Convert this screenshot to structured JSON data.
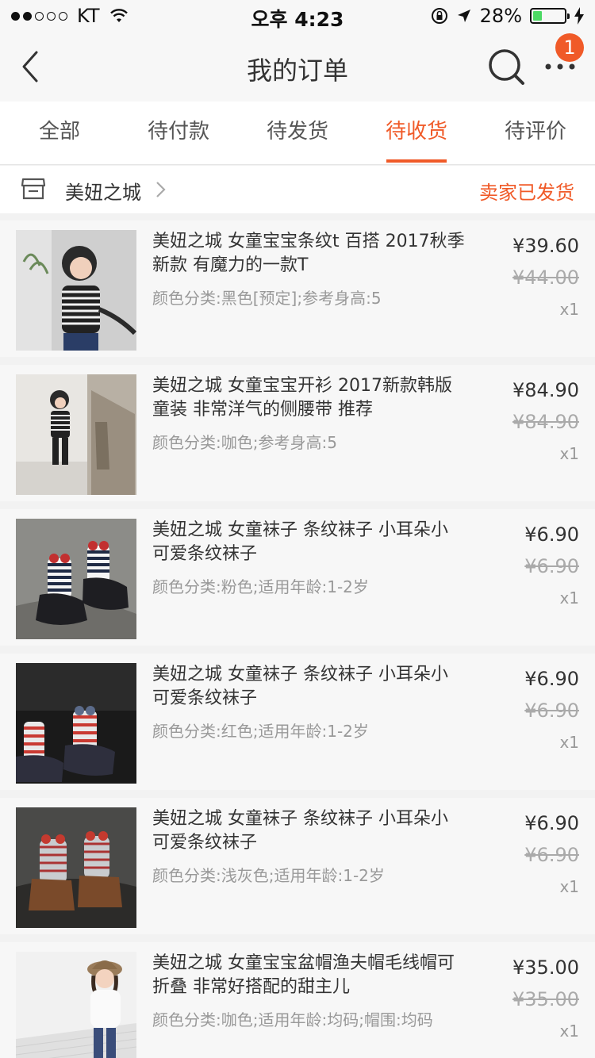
{
  "status_bar": {
    "carrier": "KT",
    "time": "오후 4:23",
    "battery": "28%",
    "battery_level": 0.28
  },
  "nav": {
    "title": "我的订单",
    "badge": "1"
  },
  "tabs": [
    {
      "label": "全部"
    },
    {
      "label": "待付款"
    },
    {
      "label": "待发货"
    },
    {
      "label": "待收货",
      "active": true
    },
    {
      "label": "待评价"
    }
  ],
  "shop": {
    "name": "美妞之城",
    "status": "卖家已发货"
  },
  "items": [
    {
      "title": "美妞之城 女童宝宝条纹t 百搭 2017秋季新款 有魔力的一款T",
      "sku": "颜色分类:黑色[预定];参考身高:5",
      "price": "¥39.60",
      "original_price": "¥44.00",
      "qty": "x1"
    },
    {
      "title": "美妞之城 女童宝宝开衫 2017新款韩版童装 非常洋气的侧腰带 推荐",
      "sku": "颜色分类:咖色;参考身高:5",
      "price": "¥84.90",
      "original_price": "¥84.90",
      "qty": "x1"
    },
    {
      "title": "美妞之城 女童袜子 条纹袜子 小耳朵小可爱条纹袜子",
      "sku": "颜色分类:粉色;适用年龄:1-2岁",
      "price": "¥6.90",
      "original_price": "¥6.90",
      "qty": "x1"
    },
    {
      "title": "美妞之城 女童袜子 条纹袜子 小耳朵小可爱条纹袜子",
      "sku": "颜色分类:红色;适用年龄:1-2岁",
      "price": "¥6.90",
      "original_price": "¥6.90",
      "qty": "x1"
    },
    {
      "title": "美妞之城 女童袜子 条纹袜子 小耳朵小可爱条纹袜子",
      "sku": "颜色分类:浅灰色;适用年龄:1-2岁",
      "price": "¥6.90",
      "original_price": "¥6.90",
      "qty": "x1"
    },
    {
      "title": "美妞之城 女童宝宝盆帽渔夫帽毛线帽可折叠 非常好搭配的甜主儿",
      "sku": "颜色分类:咖色;适用年龄:均码;帽围:均码",
      "price": "¥35.00",
      "original_price": "¥35.00",
      "qty": "x1"
    }
  ]
}
